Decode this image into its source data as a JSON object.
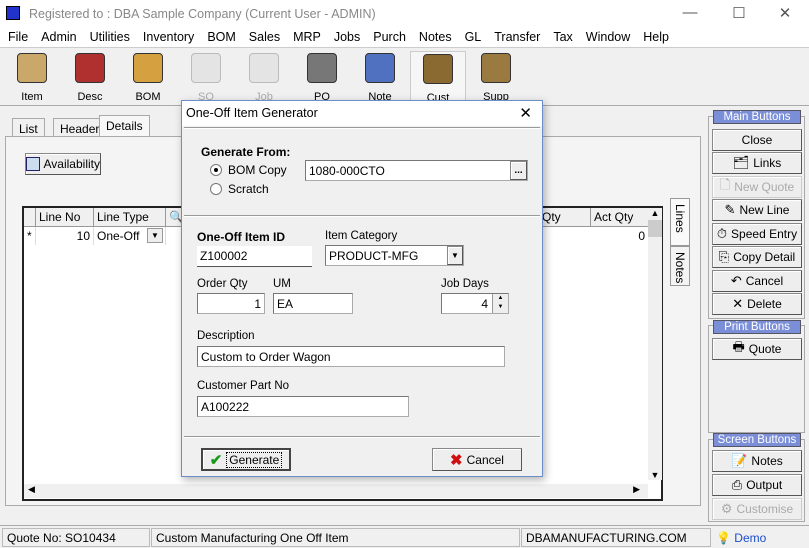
{
  "window": {
    "title": "Registered to : DBA Sample Company (Current User - ADMIN)",
    "minimize": "—",
    "maximize": "☐",
    "close": "✕"
  },
  "menu": [
    "File",
    "Admin",
    "Utilities",
    "Inventory",
    "BOM",
    "Sales",
    "MRP",
    "Jobs",
    "Purch",
    "Notes",
    "GL",
    "Transfer",
    "Tax",
    "Window",
    "Help"
  ],
  "toolbar": [
    {
      "label": "Item",
      "enabled": true
    },
    {
      "label": "Desc",
      "enabled": true
    },
    {
      "label": "BOM",
      "enabled": true
    },
    {
      "label": "SO",
      "enabled": false
    },
    {
      "label": "Job",
      "enabled": false
    },
    {
      "label": "PO",
      "enabled": true
    },
    {
      "label": "Note",
      "enabled": true
    },
    {
      "label": "Cust",
      "enabled": true
    },
    {
      "label": "Supp",
      "enabled": true
    }
  ],
  "tabs": [
    "List",
    "Header",
    "Details"
  ],
  "active_tab": "Details",
  "availability_label": "Availability",
  "grid": {
    "headers": {
      "line_no": "Line No",
      "line_type": "Line Type",
      "qty": "Qty",
      "act_qty": "Act Qty"
    },
    "row": {
      "indicator": "*",
      "line_no": "10",
      "line_type": "One-Off",
      "act_qty": "0"
    }
  },
  "side_tabs": [
    "Lines",
    "Notes"
  ],
  "right": {
    "main_header": "Main Buttons",
    "main": [
      {
        "label": "Close",
        "icon": "none",
        "enabled": true
      },
      {
        "label": "Links",
        "icon": "links-icon",
        "enabled": true
      },
      {
        "label": "New Quote",
        "icon": "document-icon",
        "enabled": false
      },
      {
        "label": "New Line",
        "icon": "pencil-icon",
        "enabled": true
      },
      {
        "label": "Speed Entry",
        "icon": "stopwatch-icon",
        "enabled": true
      },
      {
        "label": "Copy Detail",
        "icon": "copy-icon",
        "enabled": true
      },
      {
        "label": "Cancel",
        "icon": "undo-icon",
        "enabled": true
      },
      {
        "label": "Delete",
        "icon": "x-icon",
        "enabled": true
      }
    ],
    "print_header": "Print Buttons",
    "print": [
      {
        "label": "Quote",
        "icon": "print-icon",
        "enabled": true
      }
    ],
    "screen_header": "Screen Buttons",
    "screen": [
      {
        "label": "Notes",
        "icon": "notes-icon",
        "enabled": true
      },
      {
        "label": "Output",
        "icon": "output-icon",
        "enabled": true
      },
      {
        "label": "Customise",
        "icon": "customise-icon",
        "enabled": false
      }
    ]
  },
  "status": {
    "quote": "Quote No: SO10434",
    "desc": "Custom Manufacturing One Off Item",
    "site": "DBAMANUFACTURING.COM",
    "mode": "Demo"
  },
  "dialog": {
    "title": "One-Off Item Generator",
    "close": "✕",
    "generate_from": "Generate From:",
    "radio_bom": "BOM Copy",
    "radio_scratch": "Scratch",
    "selected": "BOM Copy",
    "bom_value": "1080-000CTO",
    "browse": "...",
    "item_id_label": "One-Off Item ID",
    "item_id": "Z100002",
    "category_label": "Item Category",
    "category": "PRODUCT-MFG",
    "order_qty_label": "Order Qty",
    "order_qty": "1",
    "um_label": "UM",
    "um": "EA",
    "job_days_label": "Job Days",
    "job_days": "4",
    "description_label": "Description",
    "description": "Custom to Order Wagon",
    "cust_part_label": "Customer Part No",
    "cust_part": "A100222",
    "generate": "Generate",
    "cancel": "Cancel"
  }
}
